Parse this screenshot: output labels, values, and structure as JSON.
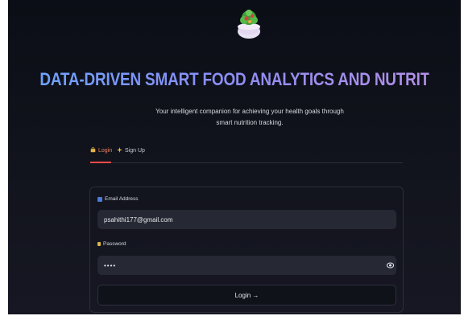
{
  "app": {
    "title": "DATA-DRIVEN SMART FOOD ANALYTICS AND NUTRITION ADVISOR",
    "subtitle_line1": "Your intelligent companion for achieving your health goals through",
    "subtitle_line2": "smart nutrition tracking.",
    "logo_icon": "salad-bowl-icon"
  },
  "tabs": [
    {
      "label": "Login",
      "icon": "key-icon",
      "active": true
    },
    {
      "label": "Sign Up",
      "icon": "sparkles-icon",
      "active": false
    }
  ],
  "form": {
    "email_label": "Email Address",
    "email_icon": "email-icon",
    "email_value": "psahithi177@gmail.com",
    "password_label": "Password",
    "password_icon": "lock-icon",
    "password_value": "••••",
    "show_password_icon": "eye-icon",
    "submit_label": "Login →"
  },
  "colors": {
    "accent": "#ff4b4b",
    "title_gradient_start": "#6ea2ff",
    "title_gradient_end": "#b48fe8",
    "background": "#0e1117"
  }
}
